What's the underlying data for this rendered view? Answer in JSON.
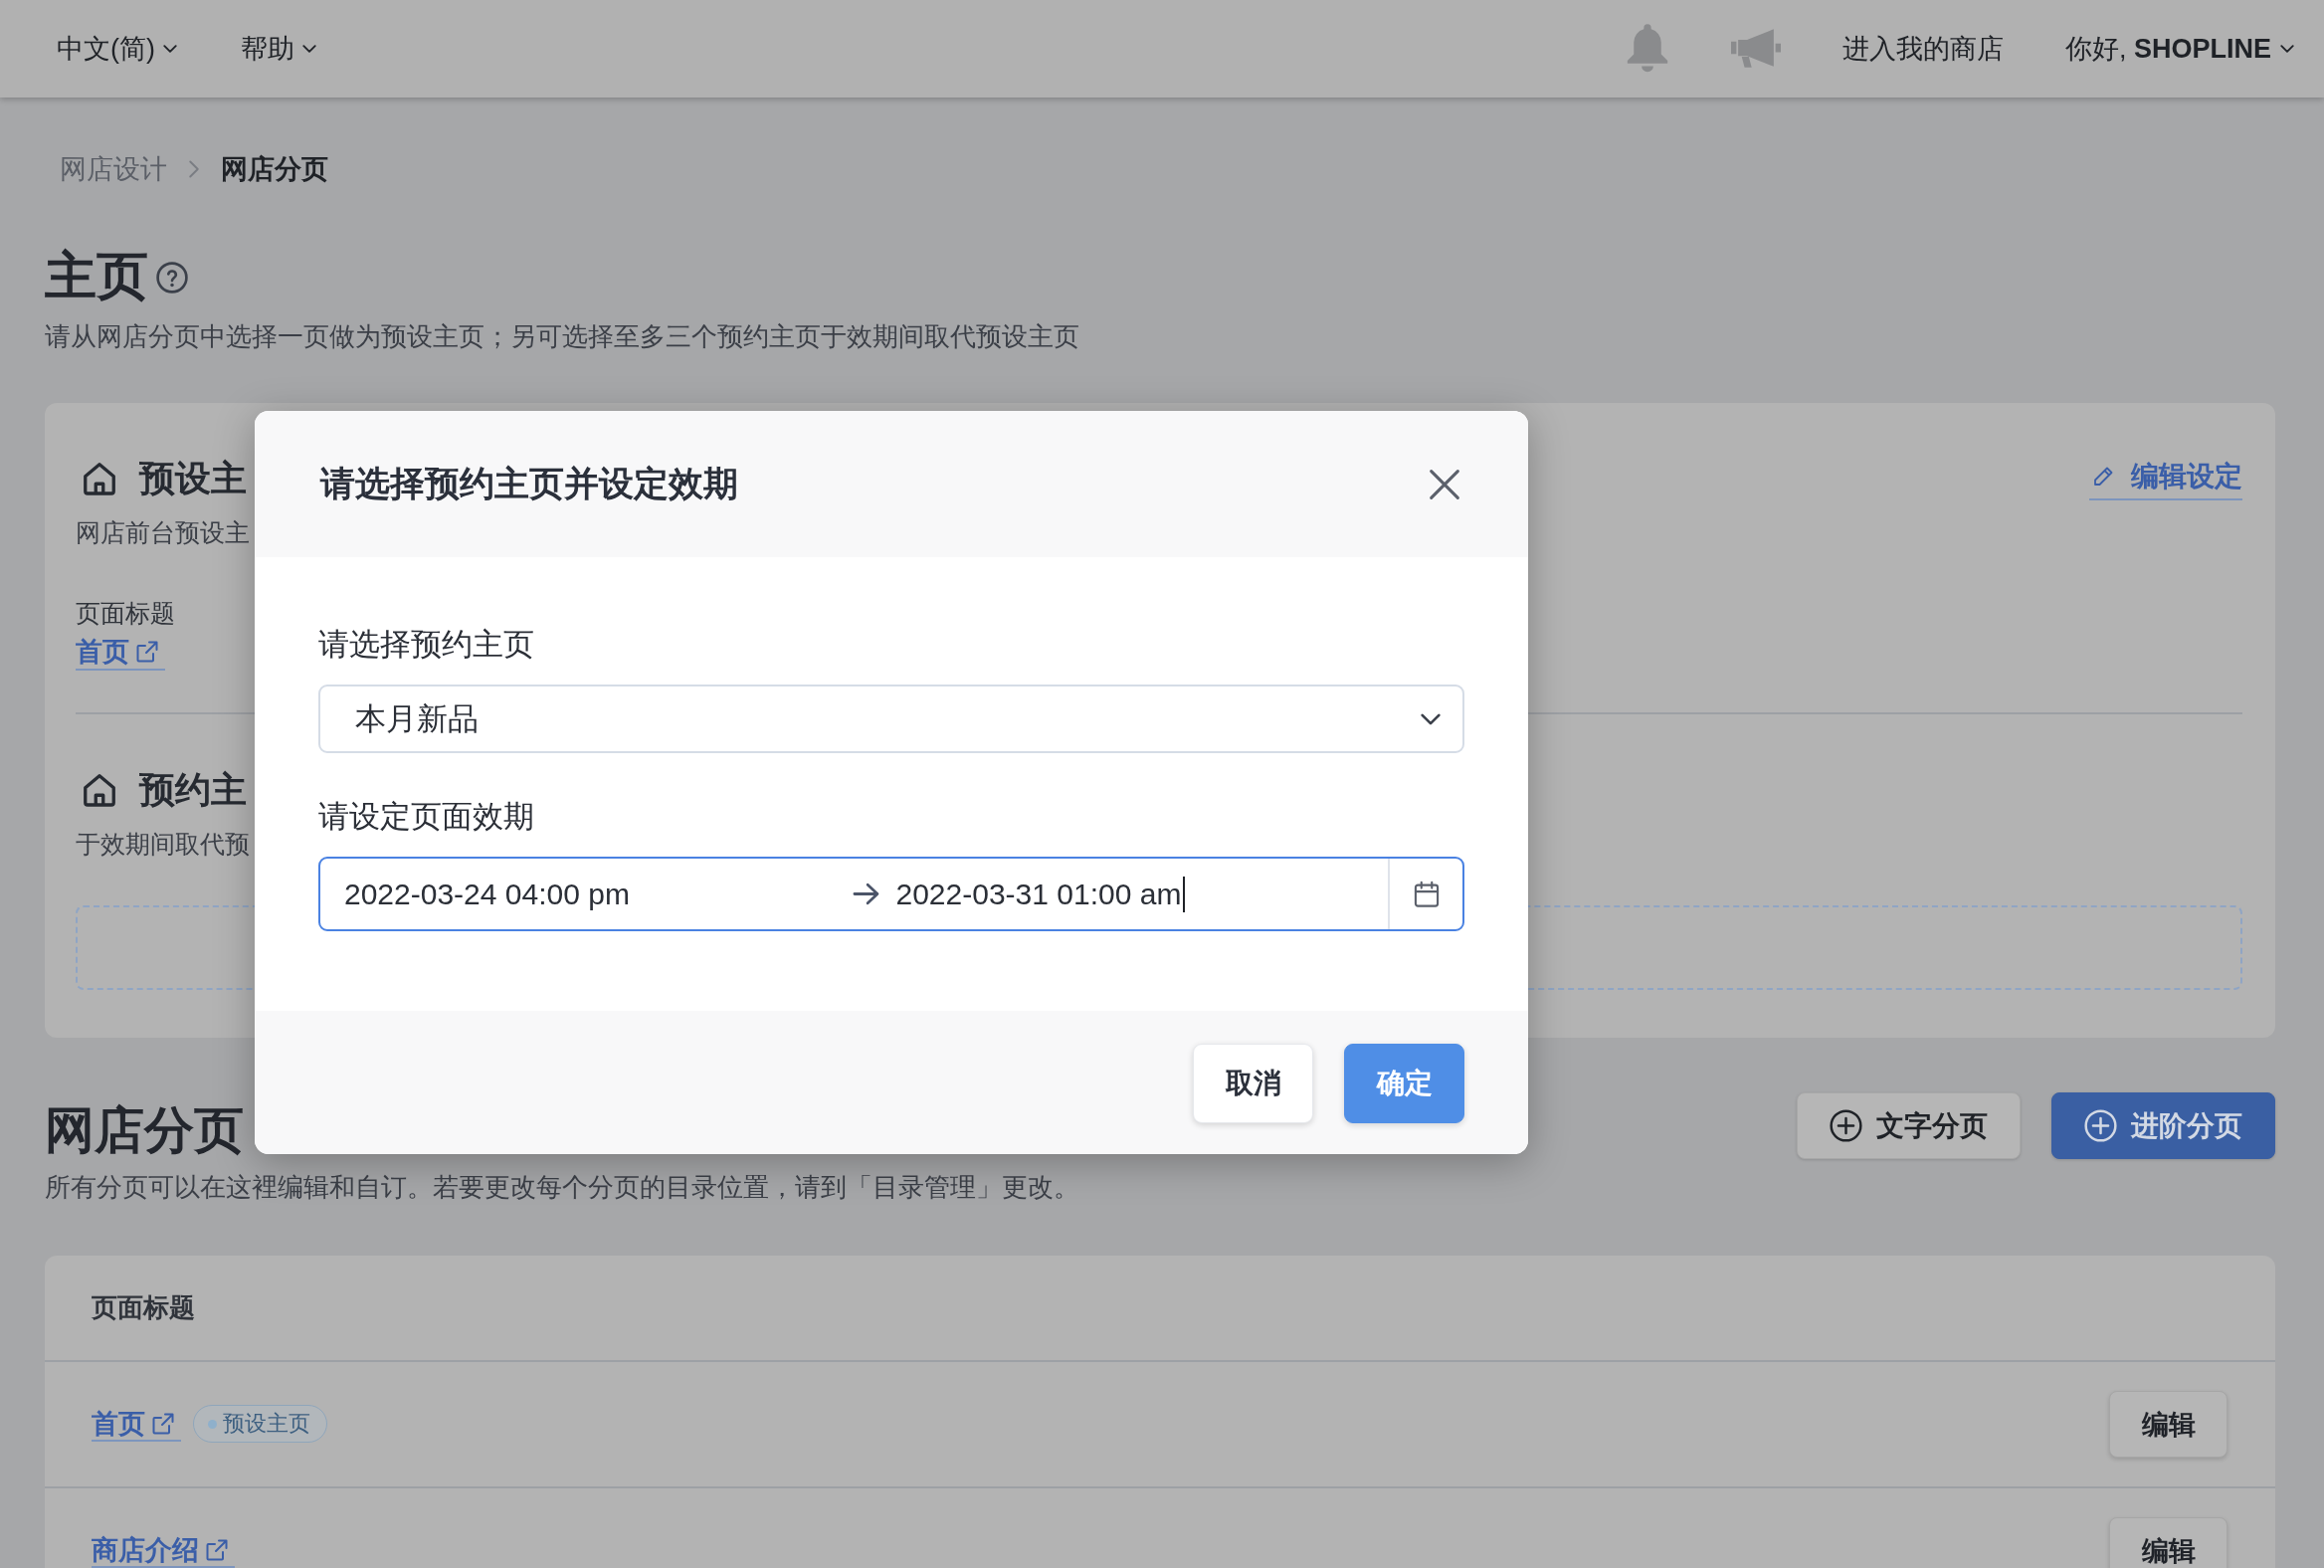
{
  "top_bar": {
    "menus": [
      {
        "label": "中文(简)"
      },
      {
        "label": "帮助"
      }
    ],
    "store_link": "进入我的商店",
    "user_menu": "你好, **SHOPLINE**"
  },
  "breadcrumb": [
    {
      "label": "网店设计",
      "current": false
    },
    {
      "label": "网店分页",
      "current": true
    }
  ],
  "homepage": {
    "title": "主页",
    "description": "请从网店分页中选择一页做为预设主页；另可选择至多三个预约主页于效期间取代预设主页",
    "default_section": {
      "title": "预设主",
      "subtitle": "网店前台预设主",
      "field_label": "页面标题",
      "page_link": "首页",
      "edit_link": "编辑设定"
    },
    "scheduled_section": {
      "title": "预约主",
      "subtitle": "于效期间取代预"
    }
  },
  "pages": {
    "title": "网店分页",
    "description": "所有分页可以在这裡编辑和自订。若要更改每个分页的目录位置，请到「目录管理」更改。",
    "buttons": [
      {
        "label": "文字分页",
        "primary": false
      },
      {
        "label": "进阶分页",
        "primary": true
      }
    ],
    "table": {
      "columns": [
        "页面标题"
      ],
      "rows": [
        {
          "title": "首页",
          "tag": "预设主页",
          "action": "编辑"
        },
        {
          "title": "商店介绍",
          "action": "编辑"
        }
      ]
    }
  },
  "modal": {
    "title": "请选择预约主页并设定效期",
    "page_select": {
      "label": "请选择预约主页",
      "value": "本月新品"
    },
    "date_range": {
      "label": "请设定页面效期",
      "start": "2022-03-24 04:00 pm",
      "end": "2022-03-31 01:00 am",
      "focused": true
    },
    "buttons": [
      {
        "label": "取消",
        "primary": false
      },
      {
        "label": "确定",
        "primary": true
      }
    ]
  }
}
